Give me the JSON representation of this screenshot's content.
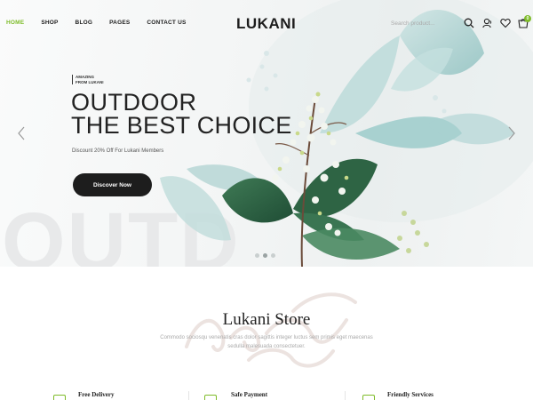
{
  "header": {
    "nav": [
      {
        "label": "HOME",
        "active": true
      },
      {
        "label": "SHOP",
        "active": false
      },
      {
        "label": "BLOG",
        "active": false
      },
      {
        "label": "PAGES",
        "active": false
      },
      {
        "label": "CONTACT US",
        "active": false
      }
    ],
    "logo": "LUKANI",
    "search_placeholder": "Search product...",
    "cart_count": "0",
    "icons": [
      "search-icon",
      "user-icon",
      "heart-icon",
      "cart-icon"
    ]
  },
  "hero": {
    "tag_line1": "AMAZING",
    "tag_line2": "FROM LUKANI",
    "title_line1": "OUTDOOR",
    "title_line2": "THE BEST CHOICE",
    "subtitle": "Discount 20% Off For Lukani Members",
    "button_label": "Discover Now",
    "bg_text": "OUTD",
    "slides": 3,
    "active_slide": 1
  },
  "store": {
    "title": "Lukani Store",
    "description": "Commodo sociosqu venenatis cras dolor sagittis integer luctus sem primis eget maecenas sedulla malesuada consectetuer.",
    "features": [
      {
        "label": "Free Delivery"
      },
      {
        "label": "Safe Payment"
      },
      {
        "label": "Friendly Services"
      }
    ]
  },
  "colors": {
    "accent": "#7fbc2a",
    "dark": "#1d1d1d"
  }
}
